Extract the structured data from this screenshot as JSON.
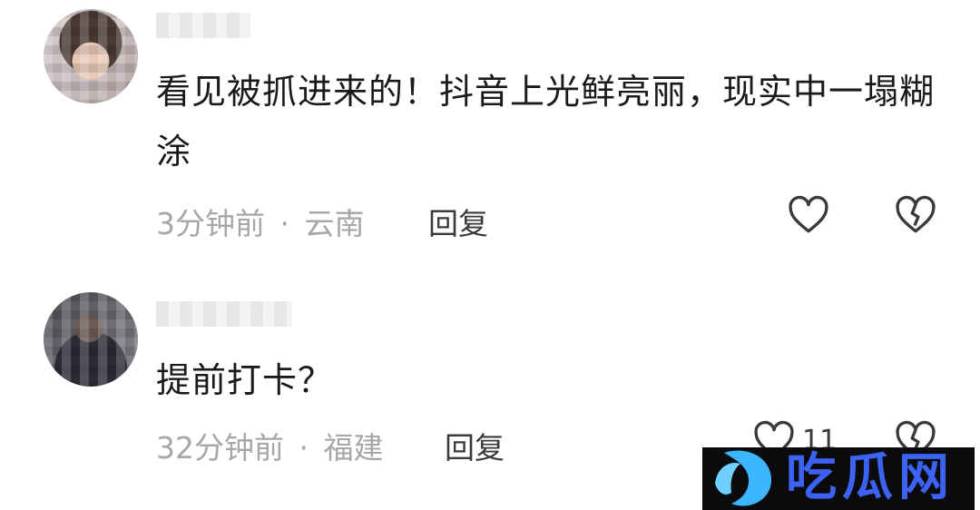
{
  "comments": [
    {
      "text": "看见被抓进来的！抖音上光鲜亮丽，现实中一塌糊涂",
      "time": "3分钟前",
      "separator": "·",
      "location": "云南",
      "reply_label": "回复",
      "like_count": ""
    },
    {
      "text": "提前打卡？",
      "time": "32分钟前",
      "separator": "·",
      "location": "福建",
      "reply_label": "回复",
      "like_count": "11"
    }
  ],
  "watermark": {
    "text": "吃瓜网",
    "color": "#3b62f0",
    "background": "#0b0b0e"
  },
  "icons": {
    "like": "heart-outline-icon",
    "dislike": "broken-heart-icon"
  },
  "colors": {
    "text": "#1a1a1a",
    "meta": "#a7a7ab",
    "reply": "#3a3a3d"
  }
}
